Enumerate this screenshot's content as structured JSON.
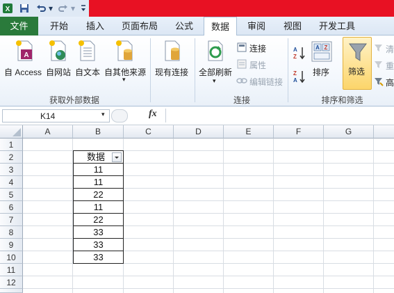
{
  "title_bar": {
    "app_icon": "excel-icon",
    "quick_access": [
      "save-icon",
      "undo-icon",
      "redo-icon",
      "customize-qat-icon"
    ]
  },
  "tabs": [
    {
      "label": "文件"
    },
    {
      "label": "开始"
    },
    {
      "label": "插入"
    },
    {
      "label": "页面布局"
    },
    {
      "label": "公式"
    },
    {
      "label": "数据"
    },
    {
      "label": "审阅"
    },
    {
      "label": "视图"
    },
    {
      "label": "开发工具"
    }
  ],
  "ribbon": {
    "get_external": {
      "access": "自 Access",
      "web": "自网站",
      "text": "自文本",
      "other": "自其他来源",
      "group_label": "获取外部数据"
    },
    "existing_conn": "现有连接",
    "connections": {
      "refresh_all": "全部刷新",
      "connections": "连接",
      "properties": "属性",
      "edit_links": "编辑链接",
      "group_label": "连接"
    },
    "sort_filter": {
      "sort": "排序",
      "filter": "筛选",
      "clear": "清",
      "reapply": "重",
      "advanced": "高",
      "group_label": "排序和筛选"
    }
  },
  "formula_bar": {
    "name_box": "K14",
    "fx": "fx",
    "formula": ""
  },
  "sheet": {
    "columns": [
      "A",
      "B",
      "C",
      "D",
      "E",
      "F",
      "G"
    ],
    "rows": [
      "1",
      "2",
      "3",
      "4",
      "5",
      "6",
      "7",
      "8",
      "9",
      "10",
      "11",
      "12"
    ],
    "header_cell": "数据",
    "values": [
      "11",
      "11",
      "22",
      "11",
      "22",
      "33",
      "33",
      "33"
    ]
  },
  "colors": {
    "file_tab": "#2a7a3b",
    "title_red": "#e81123",
    "filter_active": "#fde29a"
  }
}
